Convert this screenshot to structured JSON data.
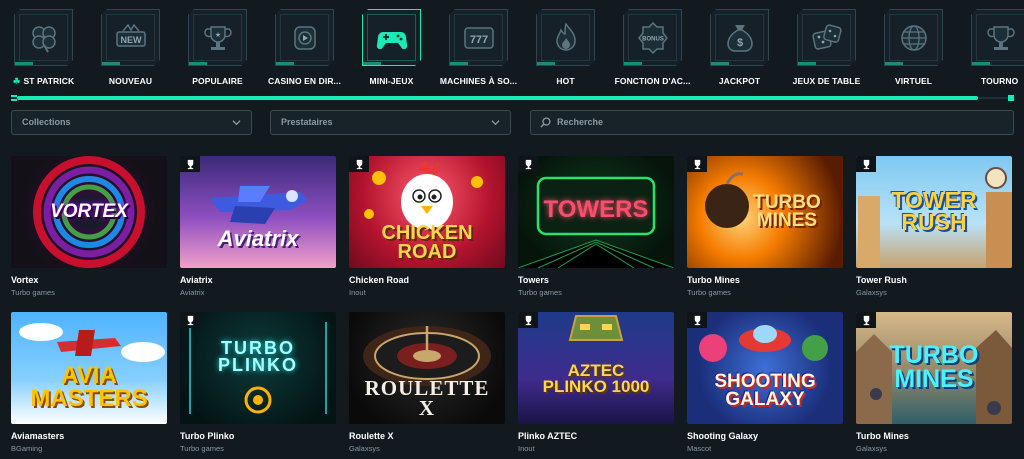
{
  "categories": [
    {
      "label": "ST PATRICK",
      "icon": "clover-icon",
      "prefix": "☘"
    },
    {
      "label": "NOUVEAU",
      "icon": "new-badge-icon",
      "badge": "NEW"
    },
    {
      "label": "POPULAIRE",
      "icon": "trophy-icon"
    },
    {
      "label": "CASINO EN DIR...",
      "icon": "play-icon"
    },
    {
      "label": "MINI-JEUX",
      "icon": "gamepad-icon",
      "active": true
    },
    {
      "label": "MACHINES À SO...",
      "icon": "slot-777-icon",
      "badge": "777"
    },
    {
      "label": "HOT",
      "icon": "flame-icon"
    },
    {
      "label": "FONCTION D'AC...",
      "icon": "bonus-icon",
      "badge": "BONUS"
    },
    {
      "label": "JACKPOT",
      "icon": "money-bag-icon"
    },
    {
      "label": "JEUX DE TABLE",
      "icon": "dice-icon"
    },
    {
      "label": "VIRTUEL",
      "icon": "globe-icon"
    },
    {
      "label": "TOURNO",
      "icon": "cup-icon"
    }
  ],
  "scrollbar": {
    "position": 0.97
  },
  "filters": {
    "collections": "Collections",
    "providers": "Prestataires",
    "search_placeholder": "Recherche"
  },
  "colors": {
    "accent": "#1de9b6",
    "background": "#121a20"
  },
  "games": [
    {
      "name": "Vortex",
      "provider": "Turbo games",
      "art_text": "VORTEX",
      "trophy": false
    },
    {
      "name": "Aviatrix",
      "provider": "Aviatrix",
      "art_text": "Aviatrix",
      "trophy": true
    },
    {
      "name": "Chicken Road",
      "provider": "Inout",
      "art_text": "CHICKEN ROAD",
      "trophy": true
    },
    {
      "name": "Towers",
      "provider": "Turbo games",
      "art_text": "TOWERS",
      "trophy": true
    },
    {
      "name": "Turbo Mines",
      "provider": "Turbo games",
      "art_text": "TURBO MINES",
      "trophy": true
    },
    {
      "name": "Tower Rush",
      "provider": "Galaxsys",
      "art_text": "TOWER RUSH",
      "trophy": true
    },
    {
      "name": "Aviamasters",
      "provider": "BGaming",
      "art_text": "AVIA MASTERS",
      "trophy": false
    },
    {
      "name": "Turbo Plinko",
      "provider": "Turbo games",
      "art_text": "TURBO PLINKO",
      "trophy": true
    },
    {
      "name": "Roulette X",
      "provider": "Galaxsys",
      "art_text": "ROULETTE X",
      "trophy": false
    },
    {
      "name": "Plinko AZTEC",
      "provider": "Inout",
      "art_text": "AZTEC PLINKO 1000",
      "trophy": true
    },
    {
      "name": "Shooting Galaxy",
      "provider": "Mascot",
      "art_text": "SHOOTING GALAXY",
      "trophy": true
    },
    {
      "name": "Turbo Mines",
      "provider": "Galaxsys",
      "art_text": "TURBO MINES",
      "trophy": true
    }
  ]
}
